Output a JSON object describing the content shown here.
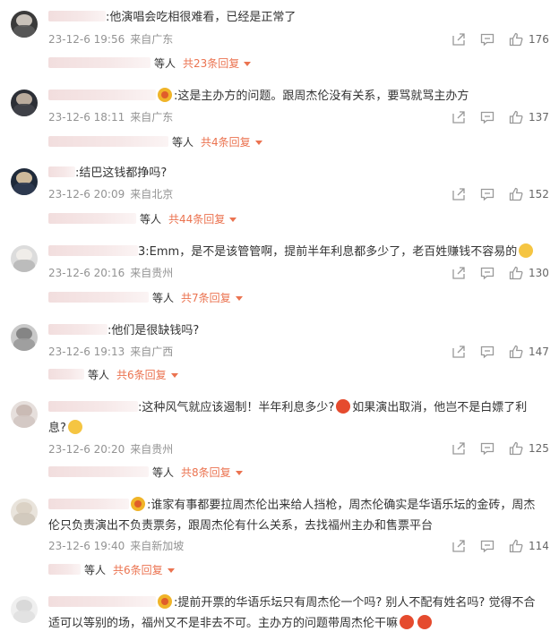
{
  "colors": {
    "accent": "#eb7350",
    "meta": "#939393",
    "text": "#333333"
  },
  "icons": {
    "share": "share-icon",
    "reply": "comment-icon",
    "like": "thumbs-up-icon",
    "expand": "triangle-down-icon"
  },
  "comments": [
    {
      "text": ":他演唱会吃相很难看，已经是正常了",
      "time": "23-12-6 19:56",
      "location": "来自广东",
      "likes": "176",
      "replies": {
        "etc": "等人",
        "total": "共23条回复"
      }
    },
    {
      "text": ":这是主办方的问题。跟周杰伦没有关系，要骂就骂主办方",
      "time": "23-12-6 18:11",
      "location": "来自广东",
      "likes": "137",
      "replies": {
        "etc": "等人",
        "total": "共4条回复"
      }
    },
    {
      "text": ":结巴这钱都挣吗?",
      "time": "23-12-6 20:09",
      "location": "来自北京",
      "likes": "152",
      "replies": {
        "etc": "等人",
        "total": "共44条回复"
      }
    },
    {
      "text": "3:Emm，是不是该管管啊，提前半年利息都多少了，老百姓赚钱不容易的",
      "time": "23-12-6 20:16",
      "location": "来自贵州",
      "likes": "130",
      "replies": {
        "etc": "等人",
        "total": "共7条回复"
      }
    },
    {
      "text": ":他们是很缺钱吗?",
      "time": "23-12-6 19:13",
      "location": "来自广西",
      "likes": "147",
      "replies": {
        "etc": "等人",
        "total": "共6条回复"
      }
    },
    {
      "text_line1a": ":这种风气就应该遏制！半年利息多少?",
      "text_line1b": "如果演出取消，他岂不是白嫖了利",
      "text_line2": "息?",
      "time": "23-12-6 20:20",
      "location": "来自贵州",
      "likes": "125",
      "replies": {
        "etc": "等人",
        "total": "共8条回复"
      }
    },
    {
      "text_line1": ":谁家有事都要拉周杰伦出来给人挡枪，周杰伦确实是华语乐坛的金砖，周杰",
      "text_line2": "伦只负责演出不负责票务，跟周杰伦有什么关系，去找福州主办和售票平台",
      "time": "23-12-6 19:40",
      "location": "来自新加坡",
      "likes": "114",
      "replies": {
        "etc": "等人",
        "total": "共6条回复"
      }
    },
    {
      "text_line1": ":提前开票的华语乐坛只有周杰伦一个吗? 别人不配有姓名吗? 觉得不合",
      "text_line2": "适可以等别的场，福州又不是非去不可。主办方的问题带周杰伦干嘛"
    }
  ]
}
